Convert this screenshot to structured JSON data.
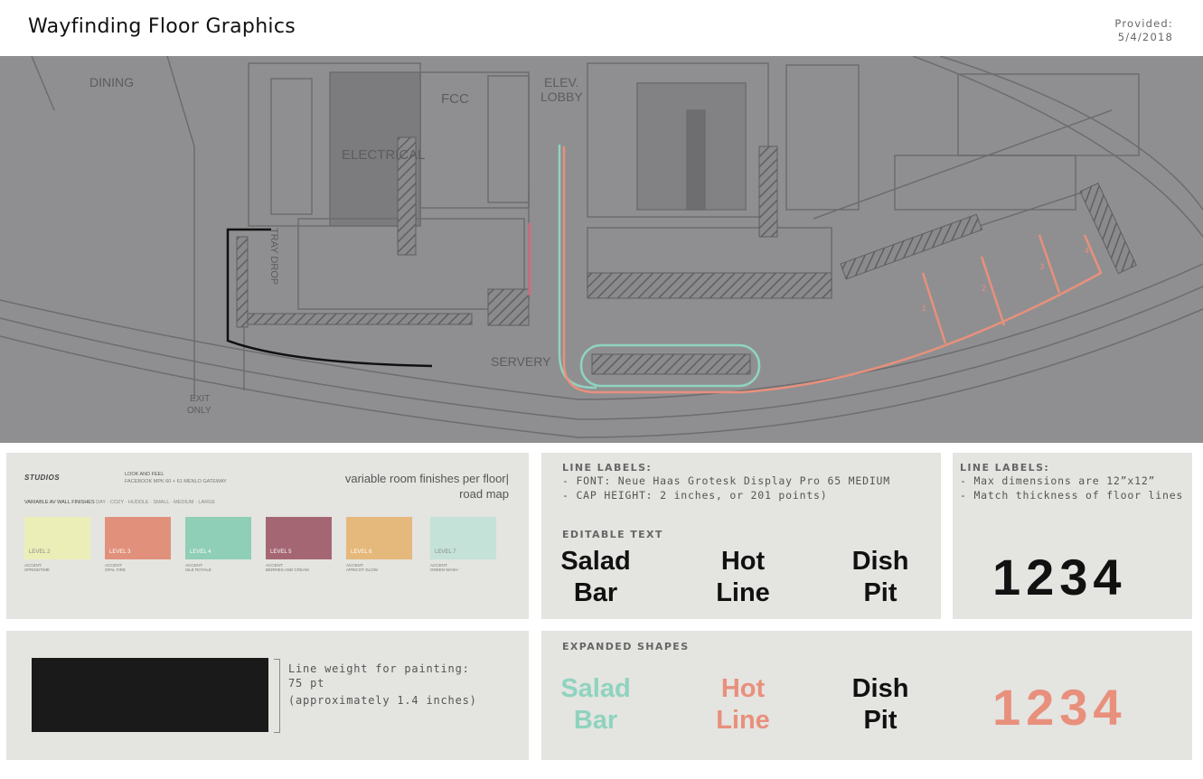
{
  "header": {
    "title": "Wayfinding Floor Graphics",
    "provided_label": "Provided:",
    "provided_date": "5/4/2018"
  },
  "plan": {
    "rooms": {
      "dining": "DINING",
      "electrical": "ELECTRICAL",
      "fcc": "FCC",
      "elev": "ELEV.",
      "lobby": "LOBBY",
      "tray_drop": "TRAY DROP",
      "servery": "SERVERY",
      "exit": "EXIT",
      "only": "ONLY"
    },
    "path_markers": [
      "1",
      "2",
      "3",
      "4"
    ],
    "colors": {
      "salad": "#8fd3bf",
      "hotline": "#e8907c",
      "dish": "#111111",
      "accent_pink": "#c9707f"
    }
  },
  "finishes": {
    "brand": "STUDIOS",
    "look_title": "LOOK AND FEEL",
    "look_sub": "FACEBOOK MPK 60 + 61 MENLO GATEWAY",
    "heading_right": "variable room finishes per floor|",
    "subheading_right": "road map",
    "wall_title": "VARIABLE AV WALL FINISHES",
    "wall_sub": "DAY · COZY · HUDDLE · SMALL · MEDIUM · LARGE",
    "swatches": [
      {
        "level": "LEVEL 2",
        "accent": "ACCENT:",
        "name": "SPRINGTIME",
        "color": "#eceeb8"
      },
      {
        "level": "LEVEL 3",
        "accent": "ACCENT:",
        "name": "OPAL FIRE",
        "color": "#e1907c"
      },
      {
        "level": "LEVEL 4",
        "accent": "ACCENT:",
        "name": "ISLE ROYALE",
        "color": "#8fceb7"
      },
      {
        "level": "LEVEL 5",
        "accent": "ACCENT:",
        "name": "BERRIES AND CREAM",
        "color": "#a56674"
      },
      {
        "level": "LEVEL 6",
        "accent": "ACCENT:",
        "name": "APRICOT GLOW",
        "color": "#e5b87b"
      },
      {
        "level": "LEVEL 7",
        "accent": "ACCENT:",
        "name": "GREEN WASH",
        "color": "#c5e2d8"
      }
    ]
  },
  "line_labels": {
    "title": "LINE LABELS:",
    "font": "- FONT: Neue Haas Grotesk Display Pro 65 MEDIUM",
    "cap": "- CAP HEIGHT: 2 inches, or 201 points)",
    "editable": "EDITABLE TEXT",
    "salad": [
      "Salad",
      "Bar"
    ],
    "hot": [
      "Hot",
      "Line"
    ],
    "dish": [
      "Dish",
      "Pit"
    ]
  },
  "line_labels_2": {
    "title": "LINE LABELS:",
    "max": "- Max dimensions are 12”x12”",
    "match": "- Match thickness of floor lines",
    "numbers": "1234"
  },
  "line_weight": {
    "label1": "Line weight for painting:",
    "label2": "75 pt",
    "label3": "(approximately 1.4 inches)"
  },
  "expanded": {
    "title": "EXPANDED SHAPES",
    "salad": [
      "Salad",
      "Bar"
    ],
    "hot": [
      "Hot",
      "Line"
    ],
    "dish": [
      "Dish",
      "Pit"
    ],
    "numbers": "1234"
  }
}
